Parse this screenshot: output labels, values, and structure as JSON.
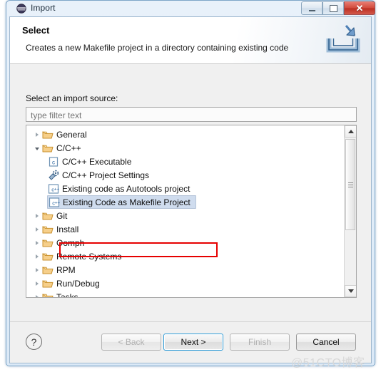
{
  "window": {
    "title": "Import",
    "app_icon": "eclipse-icon",
    "controls": {
      "minimize": "Minimize",
      "maximize": "Maximize",
      "close": "Close"
    }
  },
  "banner": {
    "title": "Select",
    "description": "Creates a new Makefile project in a directory containing existing code",
    "icon": "import-wizard-icon"
  },
  "page": {
    "source_label": "Select an import source:",
    "filter": {
      "value": "",
      "placeholder": "type filter text"
    }
  },
  "tree": {
    "items": [
      {
        "label": "General",
        "indent": 0,
        "twisty": "collapsed",
        "icon": "folder-icon",
        "selected": false
      },
      {
        "label": "C/C++",
        "indent": 0,
        "twisty": "expanded",
        "icon": "folder-icon",
        "selected": false
      },
      {
        "label": "C/C++ Executable",
        "indent": 1,
        "twisty": "none",
        "icon": "c-file-icon",
        "selected": false
      },
      {
        "label": "C/C++ Project Settings",
        "indent": 1,
        "twisty": "none",
        "icon": "project-settings-icon",
        "selected": false
      },
      {
        "label": "Existing code as Autotools project",
        "indent": 1,
        "twisty": "none",
        "icon": "cpp-file-icon",
        "selected": false
      },
      {
        "label": "Existing Code as Makefile Project",
        "indent": 1,
        "twisty": "none",
        "icon": "cpp-file-icon",
        "selected": true
      },
      {
        "label": "Git",
        "indent": 0,
        "twisty": "collapsed",
        "icon": "folder-icon",
        "selected": false
      },
      {
        "label": "Install",
        "indent": 0,
        "twisty": "collapsed",
        "icon": "folder-icon",
        "selected": false
      },
      {
        "label": "Oomph",
        "indent": 0,
        "twisty": "collapsed",
        "icon": "folder-icon",
        "selected": false
      },
      {
        "label": "Remote Systems",
        "indent": 0,
        "twisty": "collapsed",
        "icon": "folder-icon",
        "selected": false
      },
      {
        "label": "RPM",
        "indent": 0,
        "twisty": "collapsed",
        "icon": "folder-icon",
        "selected": false
      },
      {
        "label": "Run/Debug",
        "indent": 0,
        "twisty": "collapsed",
        "icon": "folder-icon",
        "selected": false
      },
      {
        "label": "Tasks",
        "indent": 0,
        "twisty": "collapsed",
        "icon": "folder-icon",
        "selected": false
      }
    ],
    "scrollbar": {
      "up_arrow": "scroll-up-icon",
      "down_arrow": "scroll-down-icon"
    },
    "annotation_color": "#e60000"
  },
  "buttons": {
    "help": "?",
    "back": "< Back",
    "next": "Next >",
    "finish": "Finish",
    "cancel": "Cancel"
  },
  "watermark": "@51CTO博客"
}
